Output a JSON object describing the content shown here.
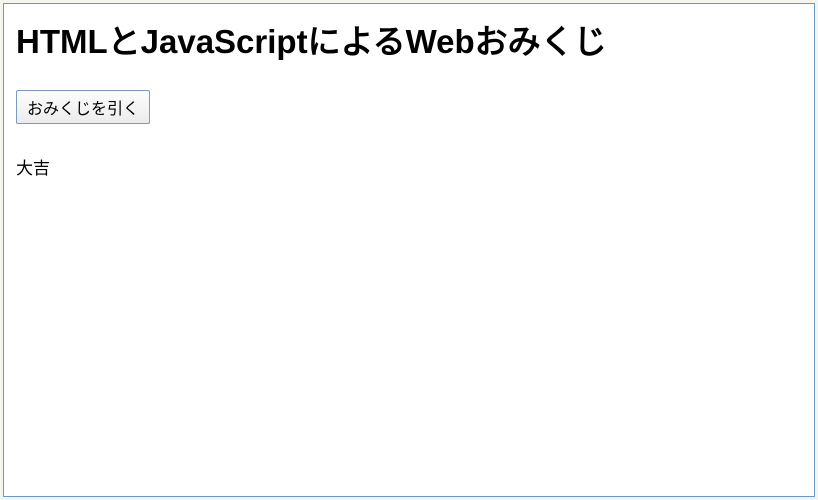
{
  "header": {
    "title": "HTMLとJavaScriptによるWebおみくじ"
  },
  "main": {
    "button_label": "おみくじを引く",
    "result": "大吉"
  }
}
